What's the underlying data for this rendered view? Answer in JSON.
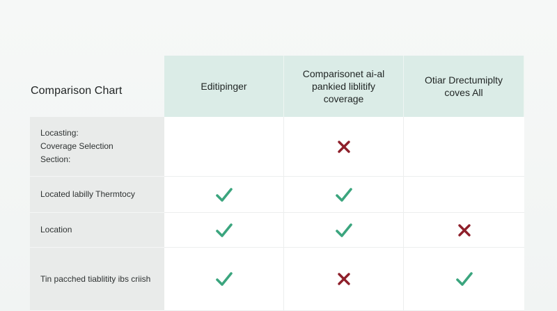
{
  "title": "Comparison Chart",
  "columns": [
    "Editipinger",
    "Comparisonet ai-al\npankied liblitify\ncoverage",
    "Otiar Drectumiplty\ncoves All"
  ],
  "rows": [
    {
      "label": "Locasting:\nCoverage Selection\nSection:",
      "values": [
        "none",
        "cross",
        "none"
      ]
    },
    {
      "label": "Located labilly Thermtocy",
      "values": [
        "check",
        "check",
        "none"
      ]
    },
    {
      "label": "Location",
      "values": [
        "check",
        "check",
        "cross"
      ]
    },
    {
      "label": "Tin pacched tiablitity ibs criish",
      "values": [
        "check",
        "cross",
        "check"
      ]
    }
  ],
  "icon_names": {
    "check": "check-icon",
    "cross": "cross-icon"
  },
  "colors": {
    "header_bg": "#dbece7",
    "check": "#3ba57e",
    "cross": "#8e1f2a",
    "label_bg": "#e9ebea"
  }
}
